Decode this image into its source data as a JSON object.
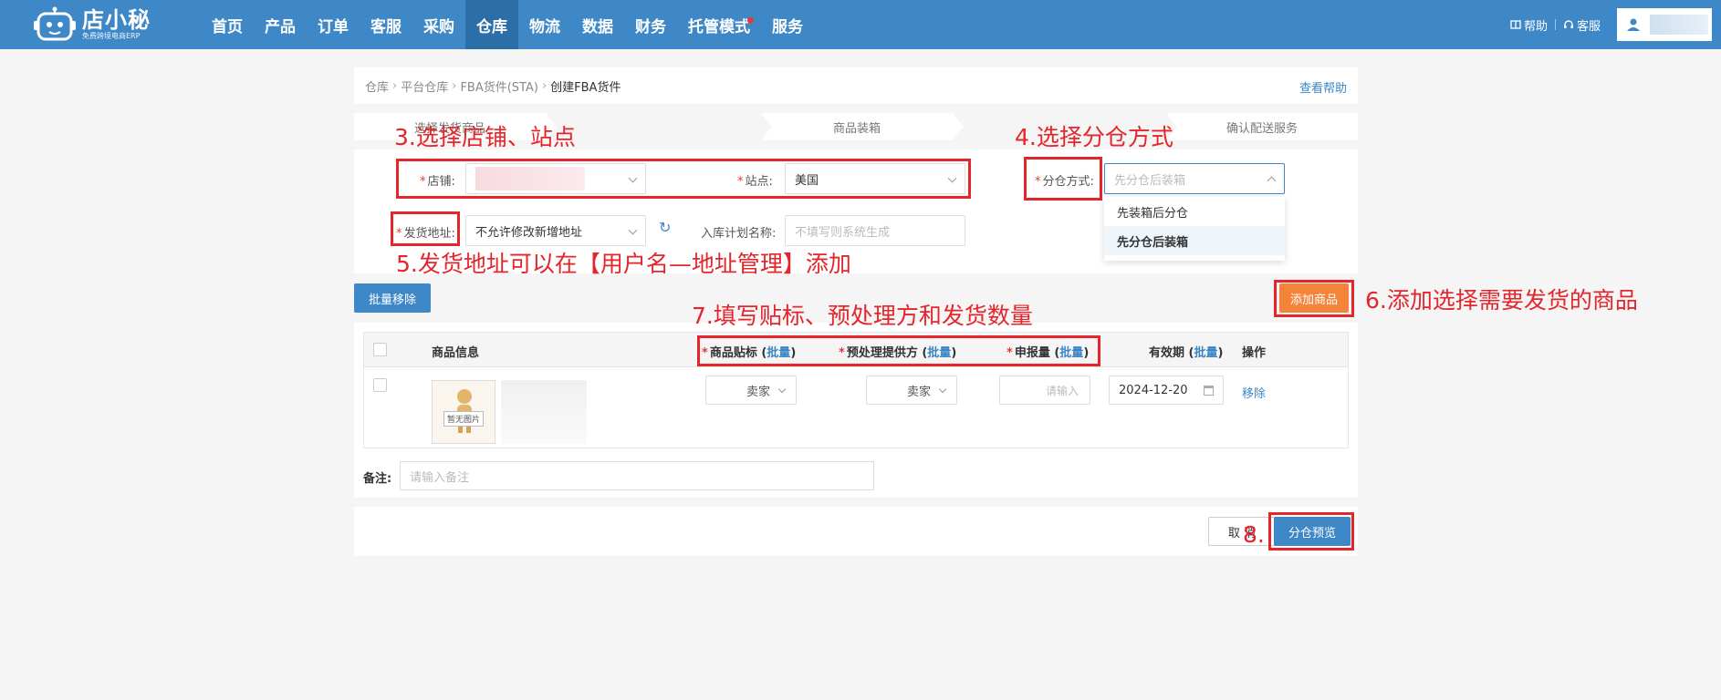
{
  "header": {
    "logo_name": "店小秘",
    "logo_sub": "免费跨境电商ERP",
    "nav": [
      {
        "label": "首页",
        "active": false
      },
      {
        "label": "产品",
        "active": false
      },
      {
        "label": "订单",
        "active": false
      },
      {
        "label": "客服",
        "active": false
      },
      {
        "label": "采购",
        "active": false
      },
      {
        "label": "仓库",
        "active": true
      },
      {
        "label": "物流",
        "active": false
      },
      {
        "label": "数据",
        "active": false
      },
      {
        "label": "财务",
        "active": false
      },
      {
        "label": "托管模式",
        "active": false,
        "dot": true
      },
      {
        "label": "服务",
        "active": false
      }
    ],
    "help_label": "帮助",
    "service_label": "客服"
  },
  "breadcrumb": {
    "items": [
      "仓库",
      "平台仓库",
      "FBA货件(STA)"
    ],
    "current": "创建FBA货件",
    "help_link": "查看帮助"
  },
  "steps": [
    "选择发货商品",
    "商品装箱",
    "确认配送服务"
  ],
  "form": {
    "store_label": "店铺:",
    "site_label": "站点:",
    "site_value": "美国",
    "split_label": "分仓方式:",
    "split_placeholder": "先分仓后装箱",
    "address_label": "发货地址:",
    "address_value": "不允许修改新增地址",
    "plan_label": "入库计划名称:",
    "plan_placeholder": "不填写则系统生成",
    "split_options": [
      "先装箱后分仓",
      "先分仓后装箱"
    ]
  },
  "actions": {
    "batch_remove": "批量移除",
    "add_product": "添加商品"
  },
  "table": {
    "headers": {
      "info": "商品信息",
      "label": "商品贴标",
      "prep": "预处理提供方",
      "qty": "申报量",
      "expiry": "有效期",
      "ops": "操作",
      "batch": "批量"
    },
    "row": {
      "img_tag": "暂无图片",
      "label_value": "卖家",
      "prep_value": "卖家",
      "qty_placeholder": "请输入",
      "expiry_value": "2024-12-20",
      "remove": "移除"
    },
    "note_label": "备注:",
    "note_placeholder": "请输入备注"
  },
  "footer": {
    "cancel": "取 消",
    "preview": "分仓预览"
  },
  "annotations": {
    "a3": "3.选择店铺、站点",
    "a4": "4.选择分仓方式",
    "a5": "5.发货地址可以在【用户名—地址管理】添加",
    "a6": "6.添加选择需要发货的商品",
    "a7": "7.填写贴标、预处理方和发货数量",
    "a8": "8."
  },
  "colors": {
    "topbar": "#3f88c8",
    "accent": "#3b86c6",
    "orange": "#f5843b",
    "annotation": "#e4252b"
  }
}
